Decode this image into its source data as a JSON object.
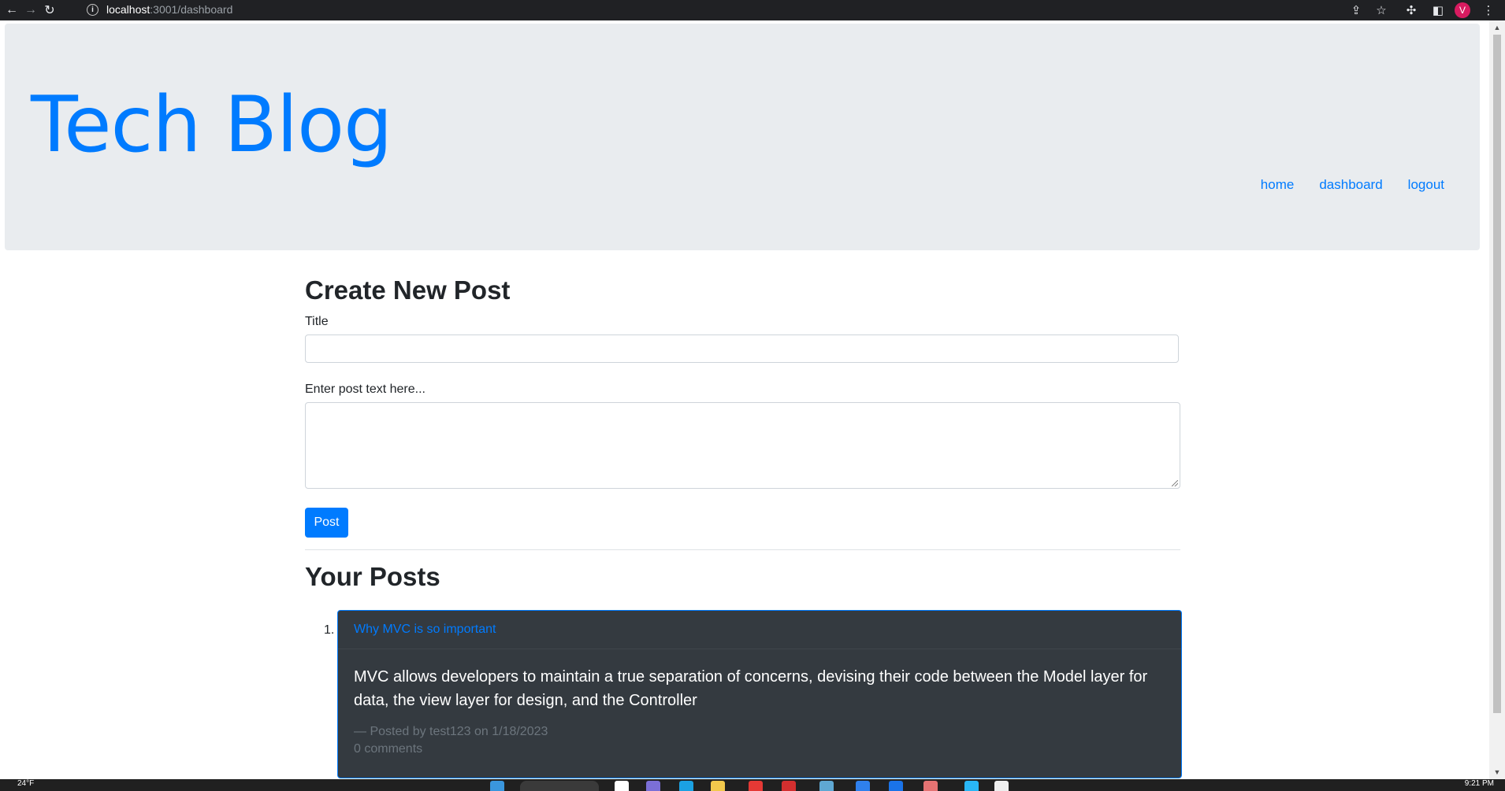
{
  "browser": {
    "url_host": "localhost",
    "url_path": ":3001/dashboard",
    "profile_initial": "V"
  },
  "header": {
    "site_title": "Tech Blog",
    "nav": [
      {
        "label": "home"
      },
      {
        "label": "dashboard"
      },
      {
        "label": "logout"
      }
    ]
  },
  "create_post": {
    "heading": "Create New Post",
    "title_label": "Title",
    "title_value": "",
    "body_label": "Enter post text here...",
    "body_value": "",
    "submit_label": "Post"
  },
  "your_posts": {
    "heading": "Your Posts",
    "items": [
      {
        "number": "1.",
        "title": "Why MVC is so important",
        "body": "MVC allows developers to maintain a true separation of concerns, devising their code between the Model layer for data, the view layer for design, and the Controller",
        "meta": "— Posted by test123 on 1/18/2023",
        "comments": "0 comments"
      }
    ]
  },
  "taskbar": {
    "weather": "24°F",
    "clock": "9:21 PM"
  },
  "colors": {
    "primary": "#007bff",
    "jumbotron_bg": "#e9ecef",
    "card_bg": "#343a40",
    "muted": "#6c757d"
  }
}
